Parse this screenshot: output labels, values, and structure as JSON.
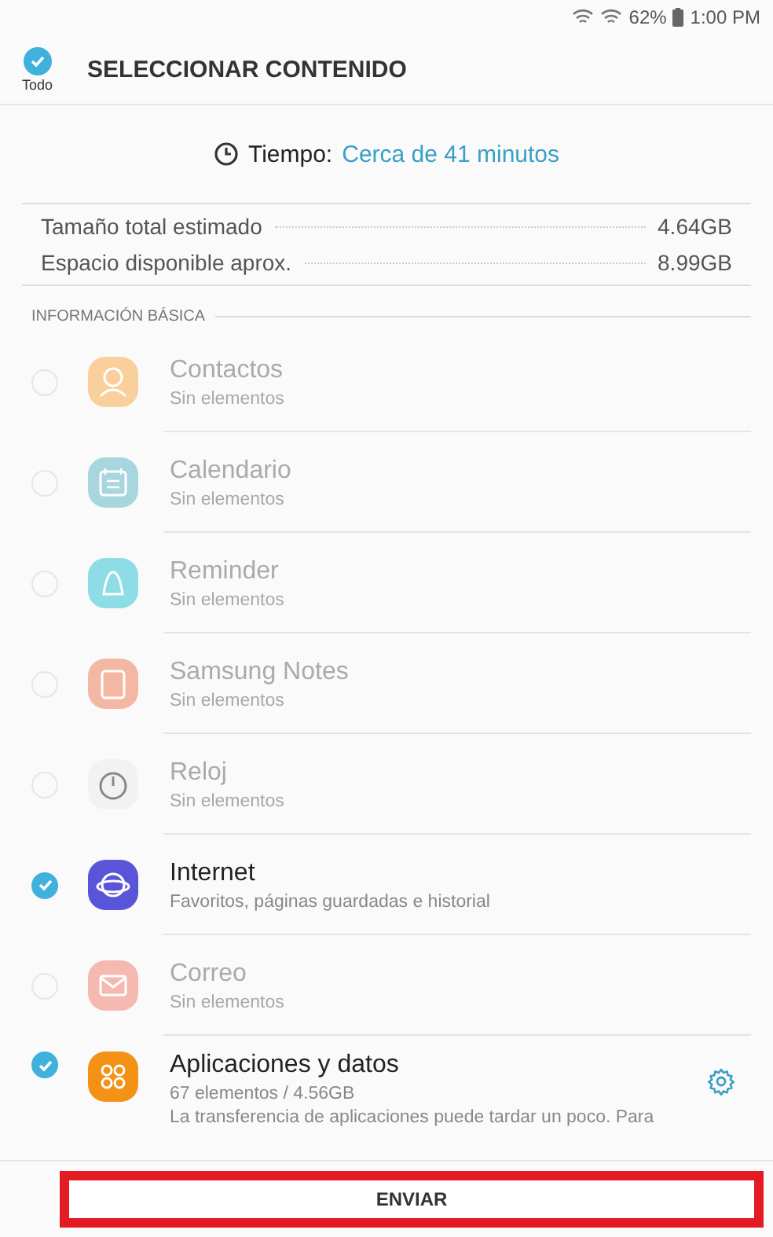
{
  "status_bar": {
    "battery": "62%",
    "time": "1:00 PM"
  },
  "header": {
    "select_all": {
      "label": "Todo",
      "checked": true
    },
    "title": "SELECCIONAR CONTENIDO"
  },
  "time_estimate": {
    "label": "Tiempo:",
    "value": "Cerca de 41 minutos"
  },
  "sizes": [
    {
      "label": "Tamaño total estimado",
      "value": "4.64GB"
    },
    {
      "label": "Espacio disponible aprox.",
      "value": "8.99GB"
    }
  ],
  "section": {
    "title": "INFORMACIÓN BÁSICA"
  },
  "items": [
    {
      "name": "Contactos",
      "detail": "Sin elementos",
      "checked": false,
      "disabled": true,
      "color": "#f9cf9c"
    },
    {
      "name": "Calendario",
      "detail": "Sin elementos",
      "checked": false,
      "disabled": true,
      "color": "#a8d6de"
    },
    {
      "name": "Reminder",
      "detail": "Sin elementos",
      "checked": false,
      "disabled": true,
      "color": "#8edde6"
    },
    {
      "name": "Samsung Notes",
      "detail": "Sin elementos",
      "checked": false,
      "disabled": true,
      "color": "#f4b7a3"
    },
    {
      "name": "Reloj",
      "detail": "Sin elementos",
      "checked": false,
      "disabled": true,
      "color": "#f2f2f2"
    },
    {
      "name": "Internet",
      "detail": "Favoritos, páginas guardadas e historial",
      "checked": true,
      "disabled": false,
      "color": "#5a55d8"
    },
    {
      "name": "Correo",
      "detail": "Sin elementos",
      "checked": false,
      "disabled": true,
      "color": "#f5b9b1"
    },
    {
      "name": "Aplicaciones y datos",
      "detail": "67 elementos / 4.56GB",
      "note": "La transferencia de aplicaciones puede tardar un poco. Para",
      "checked": true,
      "disabled": false,
      "color": "#f39215",
      "settings": true
    }
  ],
  "footer": {
    "button": "ENVIAR",
    "highlighted": true
  }
}
